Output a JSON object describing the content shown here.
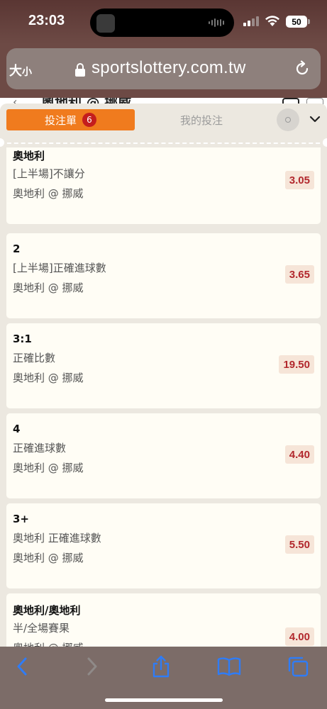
{
  "status_bar": {
    "time": "23:03",
    "battery": "50"
  },
  "browser": {
    "text_size_label": "大",
    "text_size_small": "小",
    "url": "sportslottery.com.tw"
  },
  "underlying_page": {
    "title": "奧地利 @ 挪威"
  },
  "betslip": {
    "tab_active_label": "投注單",
    "bet_count": "6",
    "tab_my_bets_label": "我的投注",
    "bets": [
      {
        "selection": "奧地利",
        "market": "[上半場]不讓分",
        "match": "奧地利 @ 挪威",
        "odds": "3.05"
      },
      {
        "selection": "2",
        "market": "[上半場]正確進球數",
        "match": "奧地利 @ 挪威",
        "odds": "3.65"
      },
      {
        "selection": "3:1",
        "market": "正確比數",
        "match": "奧地利 @ 挪威",
        "odds": "19.50"
      },
      {
        "selection": "4",
        "market": "正確進球數",
        "match": "奧地利 @ 挪威",
        "odds": "4.40"
      },
      {
        "selection": "3+",
        "market": "奧地利 正確進球數",
        "match": "奧地利 @ 挪威",
        "odds": "5.50"
      },
      {
        "selection": "奧地利/奧地利",
        "market": "半/全場賽果",
        "match": "奧地利 @ 挪威",
        "odds": "4.00"
      }
    ]
  },
  "toolbar": {
    "icons": [
      "back-icon",
      "forward-icon",
      "share-icon",
      "bookmarks-icon",
      "tabs-icon"
    ]
  },
  "colors": {
    "accent_orange": "#f07b1e",
    "badge_red": "#c41d1d",
    "odds_red": "#b2282d",
    "ios_blue": "#2f7cf6"
  }
}
